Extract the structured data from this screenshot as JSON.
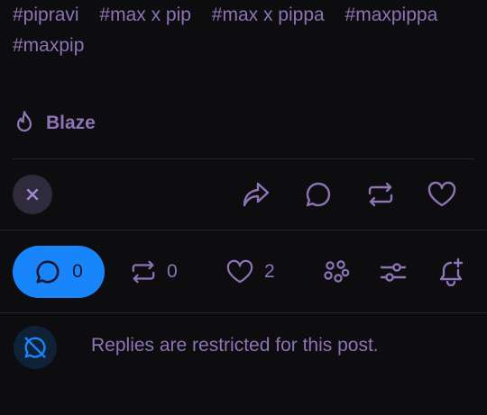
{
  "post": {
    "tags": [
      "#pipravi",
      "#max x pip",
      "#max x pippa",
      "#maxpippa",
      "#maxpip"
    ],
    "blaze_label": "Blaze"
  },
  "actions": {
    "icons": [
      "close-icon",
      "share-icon",
      "comment-icon",
      "reblog-icon",
      "heart-icon"
    ]
  },
  "stats": {
    "replies_count": "0",
    "reblogs_count": "0",
    "likes_count": "2"
  },
  "restriction": {
    "message": "Replies are restricted for this post."
  },
  "colors": {
    "accent": "#8d74b6",
    "reply_button": "#1885fb",
    "restricted_icon": "#1885fb",
    "background": "#0d0c0f"
  }
}
